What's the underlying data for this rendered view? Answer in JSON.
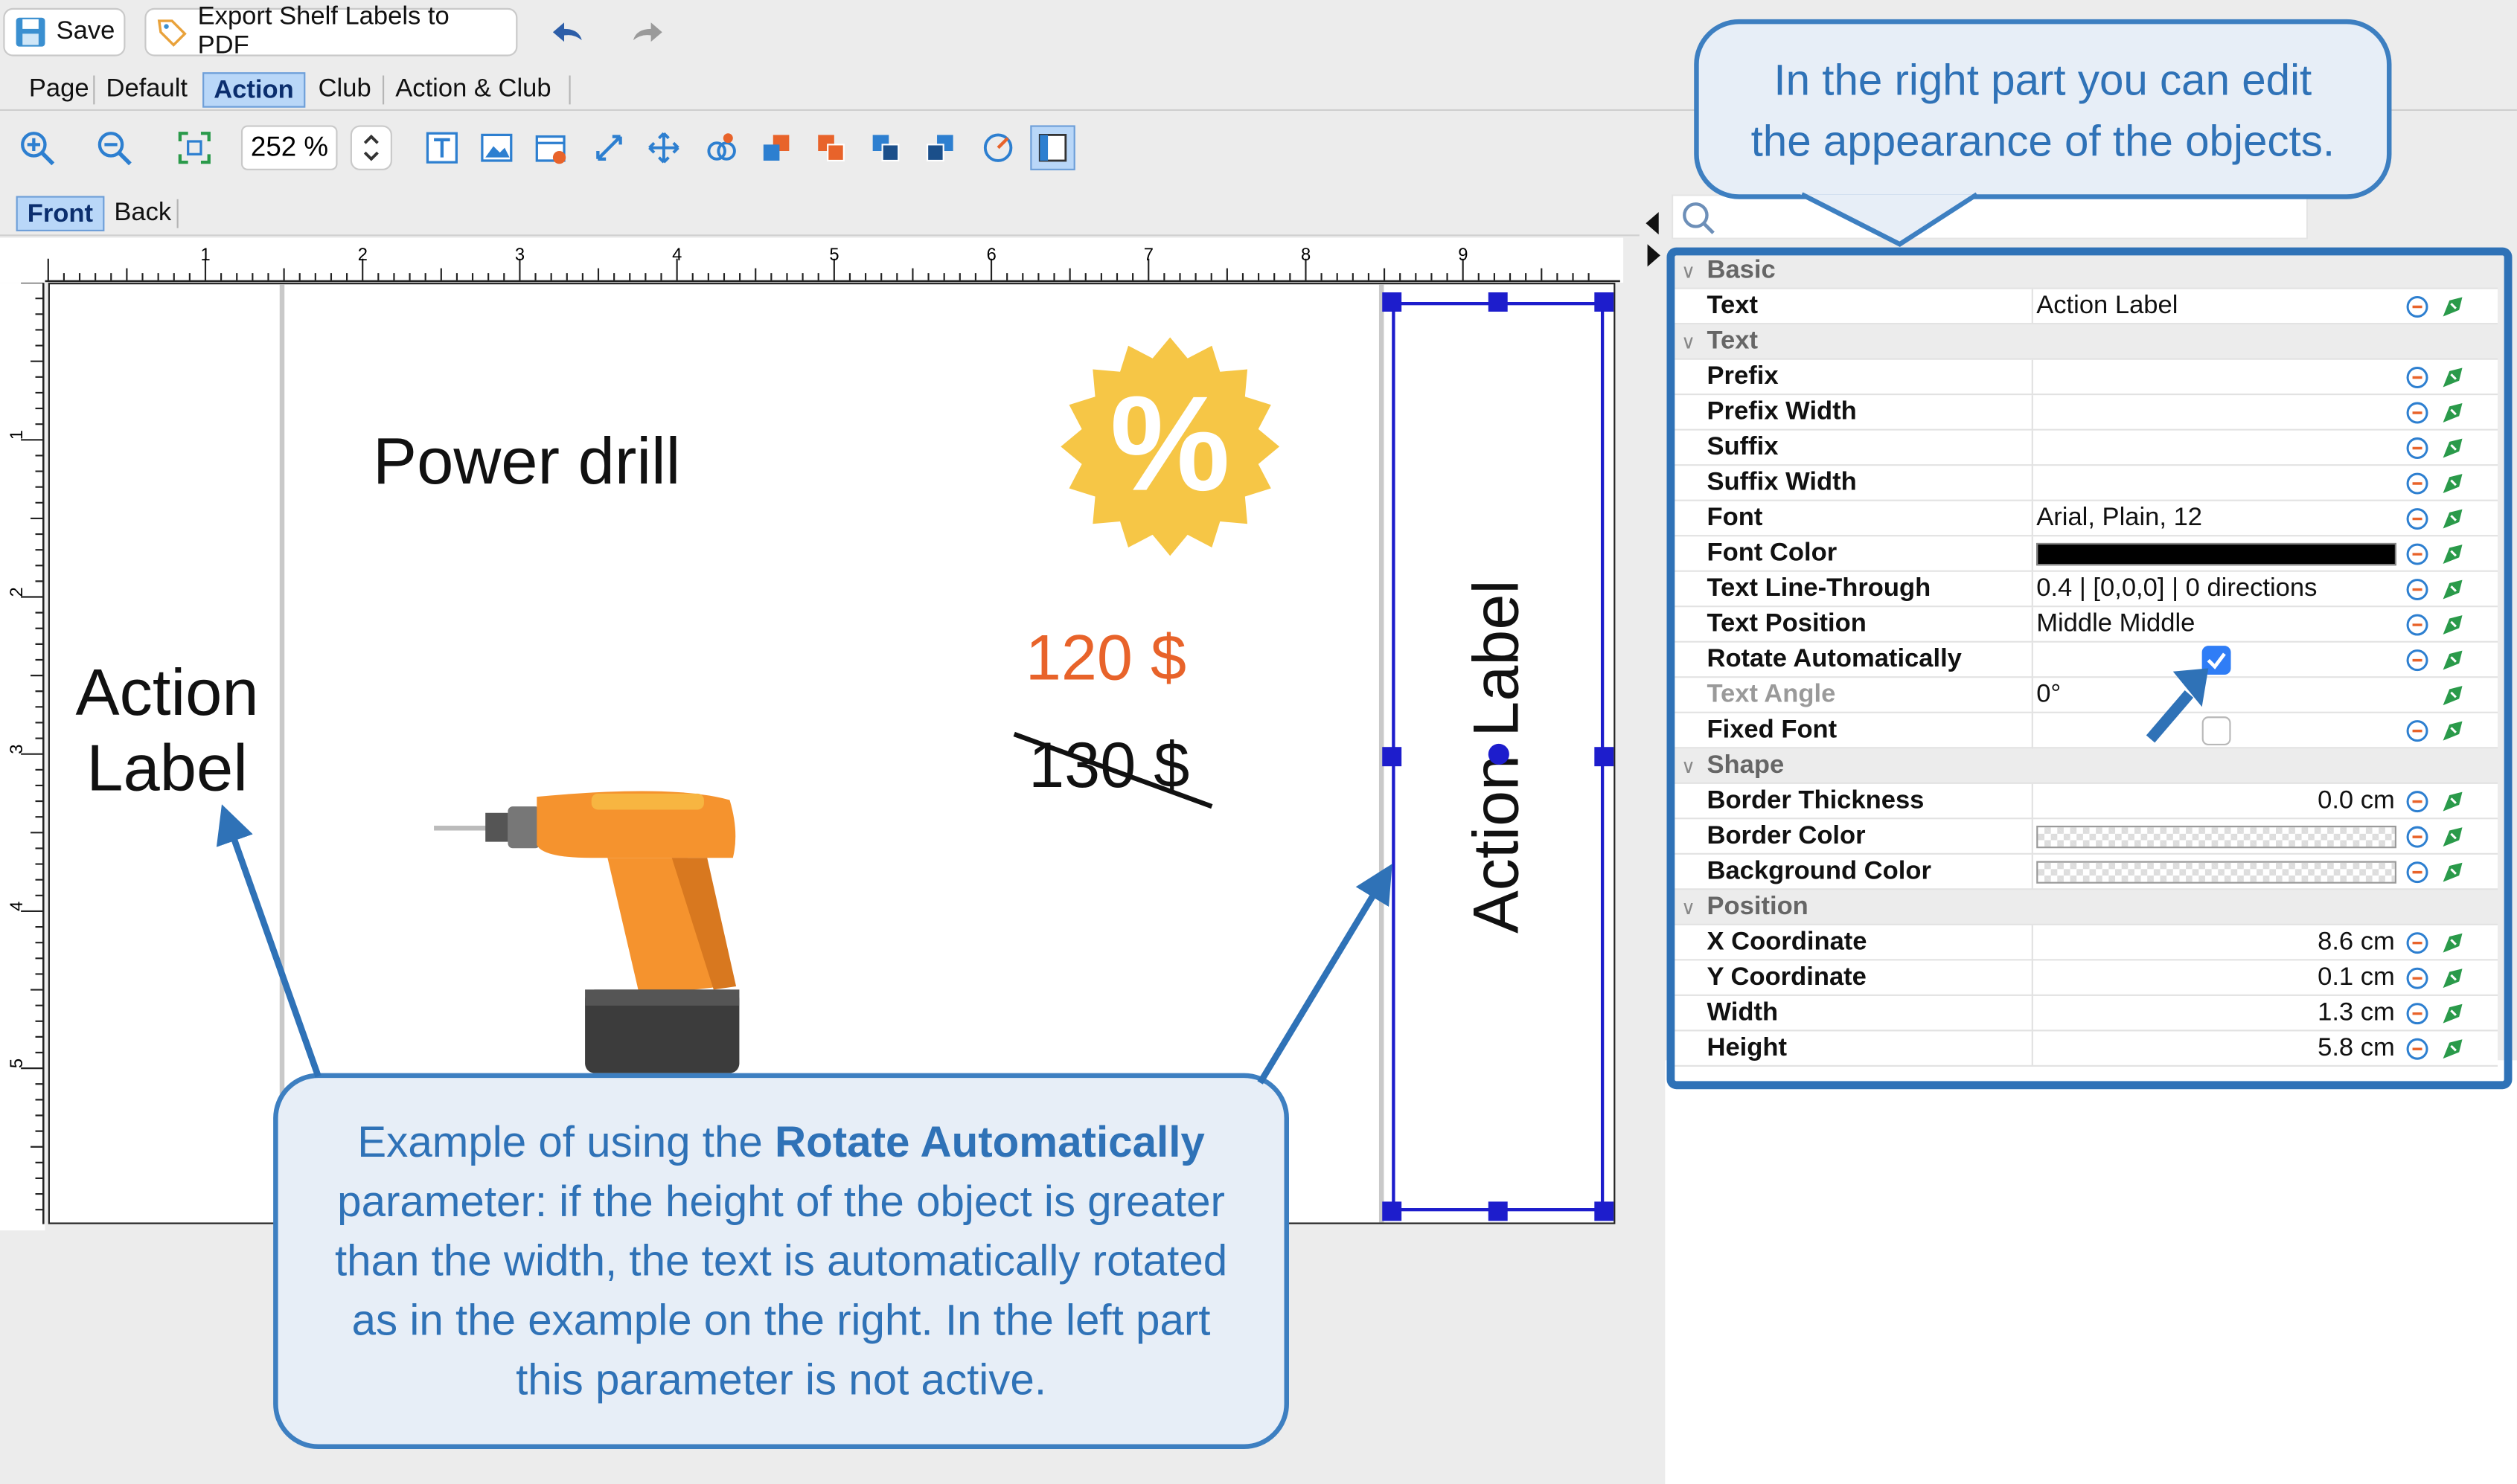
{
  "toolbar": {
    "save_label": "Save",
    "export_label": "Export Shelf Labels to PDF",
    "zoom_value": "252 %"
  },
  "template_tabs": [
    {
      "label": "Page",
      "selected": false
    },
    {
      "label": "Default",
      "selected": false
    },
    {
      "label": "Action",
      "selected": true
    },
    {
      "label": "Club",
      "selected": false
    },
    {
      "label": "Action & Club",
      "selected": false
    }
  ],
  "side_tabs": [
    {
      "label": "Front",
      "selected": true
    },
    {
      "label": "Back",
      "selected": false
    }
  ],
  "ruler": {
    "top": [
      "1",
      "2",
      "3",
      "4",
      "5",
      "6",
      "7",
      "8",
      "9"
    ],
    "left": [
      "1",
      "2",
      "3",
      "4",
      "5"
    ]
  },
  "canvas": {
    "left_label_line1": "Action",
    "left_label_line2": "Label",
    "product_name": "Power drill",
    "percent_symbol": "%",
    "new_price": "120 $",
    "old_price": "130 $",
    "rotated_label": "Action Label"
  },
  "properties": {
    "search_placeholder": "",
    "groups": [
      {
        "name": "Basic",
        "rows": [
          {
            "name": "Text",
            "value": "Action Label"
          }
        ]
      },
      {
        "name": "Text",
        "rows": [
          {
            "name": "Prefix",
            "value": ""
          },
          {
            "name": "Prefix Width",
            "value": ""
          },
          {
            "name": "Suffix",
            "value": ""
          },
          {
            "name": "Suffix Width",
            "value": ""
          },
          {
            "name": "Font",
            "value": "Arial, Plain, 12"
          },
          {
            "name": "Font Color",
            "value": "",
            "color": "#000000"
          },
          {
            "name": "Text Line-Through",
            "value": "0.4 | [0,0,0] | 0 directions"
          },
          {
            "name": "Text Position",
            "value": "Middle Middle"
          },
          {
            "name": "Rotate Automatically",
            "checked": true
          },
          {
            "name": "Text Angle",
            "value": "0°",
            "disabled": true
          },
          {
            "name": "Fixed Font",
            "checked": false
          }
        ]
      },
      {
        "name": "Shape",
        "rows": [
          {
            "name": "Border Thickness",
            "value": "0.0 cm"
          },
          {
            "name": "Border Color",
            "value": ""
          },
          {
            "name": "Background Color",
            "value": ""
          }
        ]
      },
      {
        "name": "Position",
        "rows": [
          {
            "name": "X Coordinate",
            "value": "8.6 cm"
          },
          {
            "name": "Y Coordinate",
            "value": "0.1 cm"
          },
          {
            "name": "Width",
            "value": "1.3 cm"
          },
          {
            "name": "Height",
            "value": "5.8 cm"
          }
        ]
      }
    ]
  },
  "callouts": {
    "right_line1": "In the right part you can edit",
    "right_line2": "the appearance of the objects.",
    "bottom_pre": "Example of using the ",
    "bottom_bold": "Rotate Automatically",
    "bottom_line2": "parameter: if the height of the object is greater",
    "bottom_line3": "than the width, the text is automatically rotated",
    "bottom_line4": "as in the example on the right. In the left part",
    "bottom_line5": "this parameter is not active."
  },
  "colors": {
    "accent_blue": "#2f72b7",
    "selection_blue": "#1d1dcc",
    "price_orange": "#e8632a",
    "badge_yellow": "#f6c646"
  }
}
